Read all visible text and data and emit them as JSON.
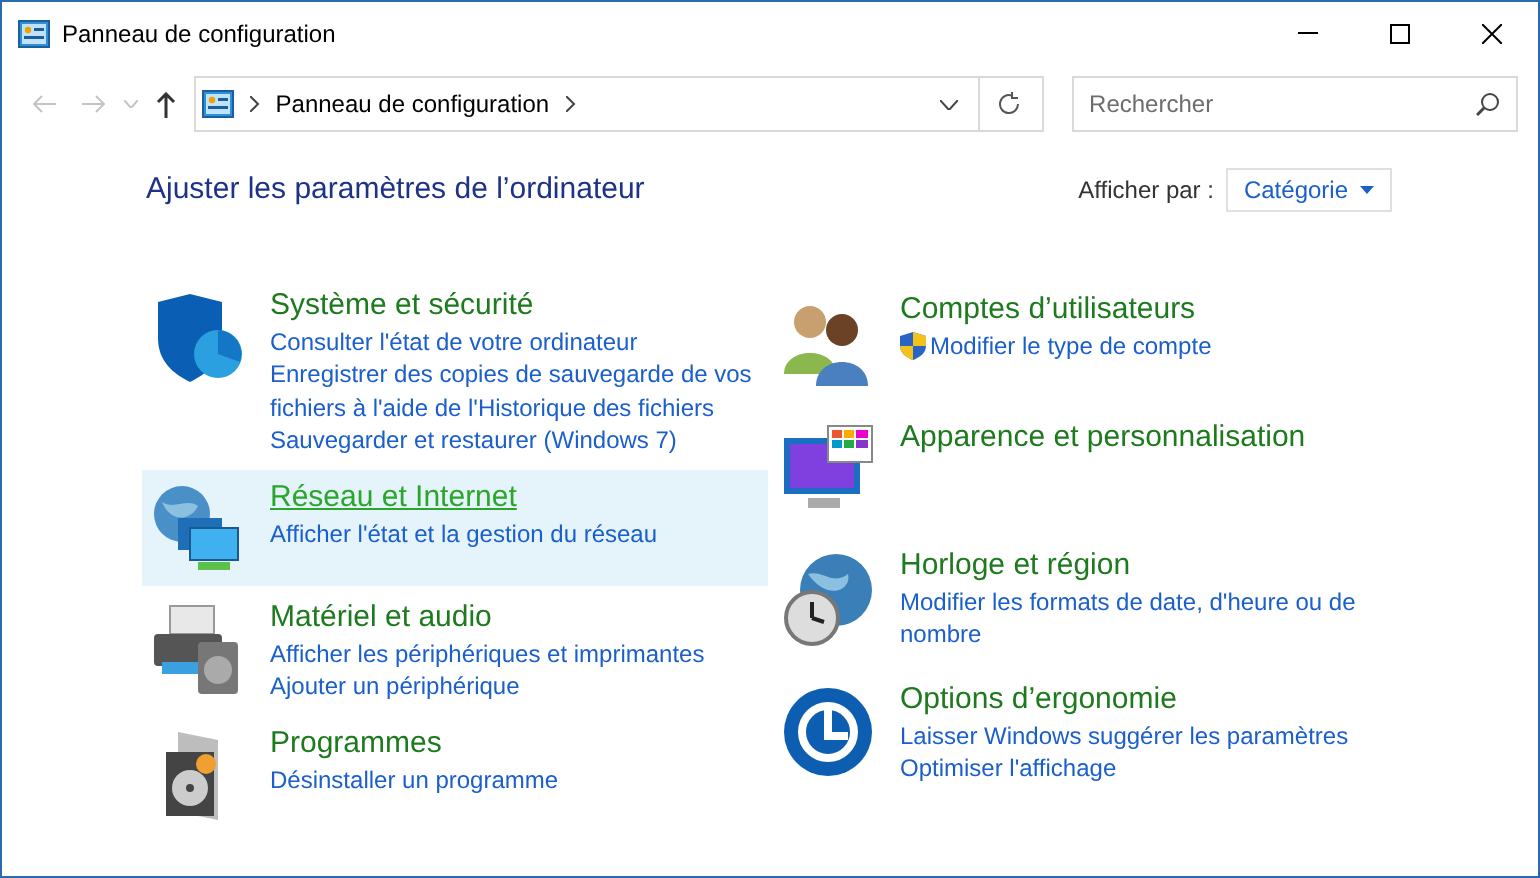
{
  "window": {
    "title": "Panneau de configuration"
  },
  "address_bar": {
    "path": "Panneau de configuration"
  },
  "search": {
    "placeholder": "Rechercher"
  },
  "heading": "Ajuster les paramètres de l’ordinateur",
  "view_by": {
    "label": "Afficher par :",
    "value": "Catégorie"
  },
  "left_categories": [
    {
      "title": "Système et sécurité",
      "selected": false,
      "links": [
        {
          "text": "Consulter l'état de votre ordinateur",
          "shield": false
        },
        {
          "text": "Enregistrer des copies de sauvegarde de vos fichiers à l'aide de l'Historique des fichiers",
          "shield": false
        },
        {
          "text": "Sauvegarder et restaurer (Windows 7)",
          "shield": false
        }
      ]
    },
    {
      "title": "Réseau et Internet",
      "selected": true,
      "links": [
        {
          "text": "Afficher l'état et la gestion du réseau",
          "shield": false
        }
      ]
    },
    {
      "title": "Matériel et audio",
      "selected": false,
      "links": [
        {
          "text": "Afficher les périphériques et imprimantes",
          "shield": false
        },
        {
          "text": "Ajouter un périphérique",
          "shield": false
        }
      ]
    },
    {
      "title": "Programmes",
      "selected": false,
      "links": [
        {
          "text": "Désinstaller un programme",
          "shield": false
        }
      ]
    }
  ],
  "right_categories": [
    {
      "title": "Comptes d’utilisateurs",
      "selected": false,
      "links": [
        {
          "text": "Modifier le type de compte",
          "shield": true
        }
      ]
    },
    {
      "title": "Apparence et personnalisation",
      "selected": false
    },
    {
      "title": "Horloge et région",
      "selected": false,
      "links": [
        {
          "text": "Modifier les formats de date, d'heure ou de nombre",
          "shield": false
        }
      ]
    },
    {
      "title": "Options d’ergonomie",
      "selected": false,
      "links": [
        {
          "text": "Laisser Windows suggérer les paramètres",
          "shield": false
        },
        {
          "text": "Optimiser l'affichage",
          "shield": false
        }
      ]
    }
  ]
}
